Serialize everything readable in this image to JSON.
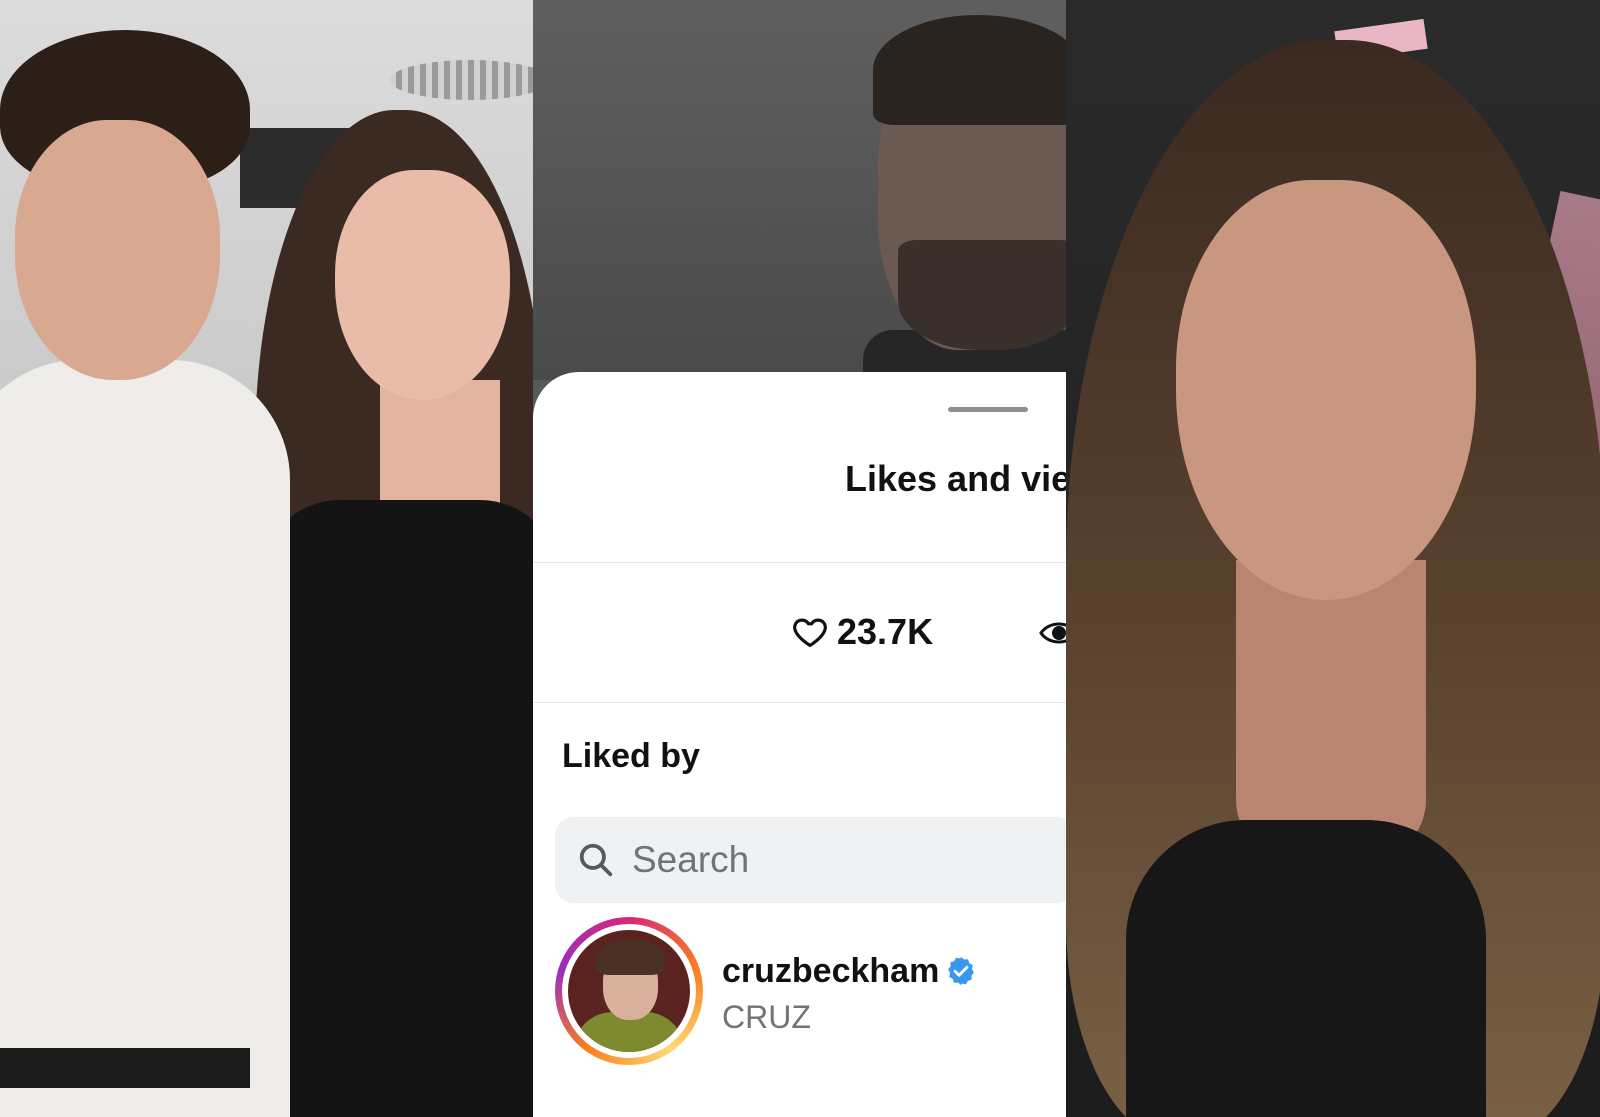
{
  "sheet": {
    "title": "Likes and vie",
    "likes_count": "23.7K",
    "liked_by_label": "Liked by",
    "search_placeholder": "Search",
    "user": {
      "username": "cruzbeckham",
      "full_name": "CRUZ",
      "verified": true
    }
  },
  "colors": {
    "sheet_bg": "#ffffff",
    "search_bg": "#eff1f3",
    "verified_blue": "#3897f0",
    "muted_text": "#6f7479"
  }
}
